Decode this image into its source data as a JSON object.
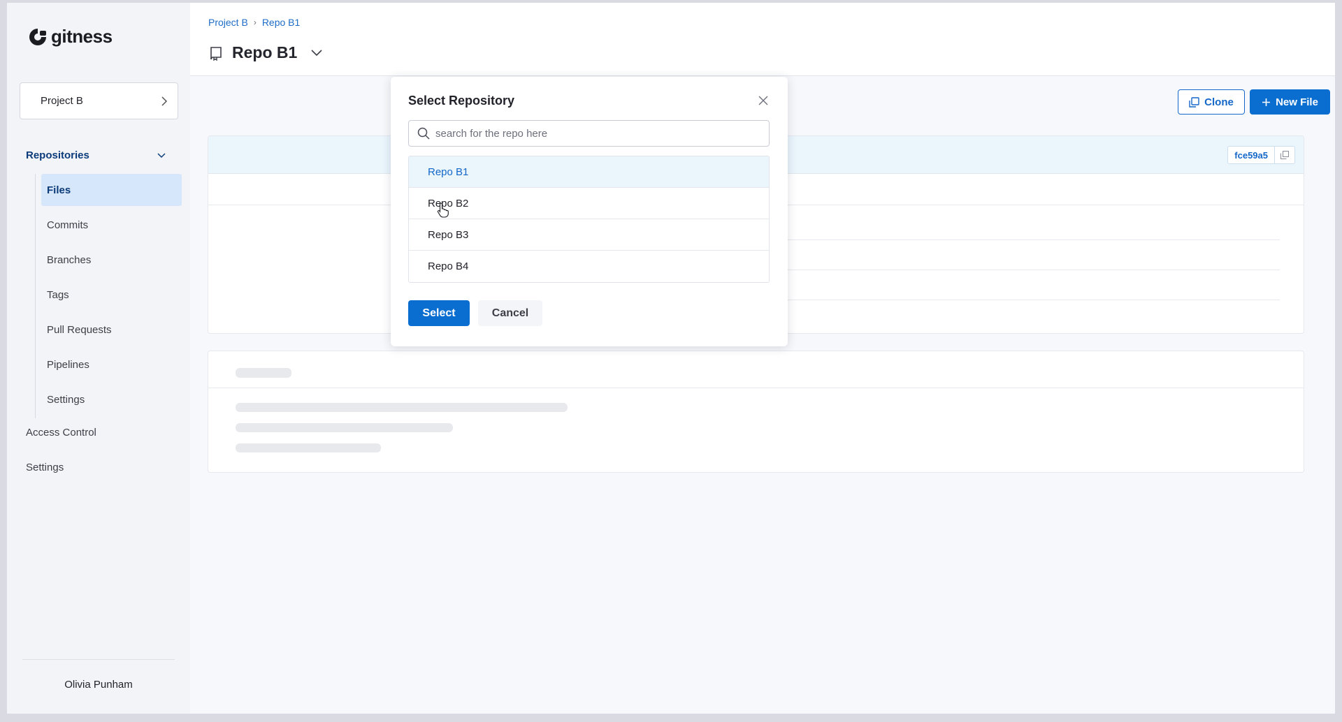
{
  "app": {
    "name": "gitness"
  },
  "sidebar": {
    "project_label": "Project B",
    "section_label": "Repositories",
    "sub_items": [
      {
        "label": "Files",
        "active": true
      },
      {
        "label": "Commits"
      },
      {
        "label": "Branches"
      },
      {
        "label": "Tags"
      },
      {
        "label": "Pull Requests"
      },
      {
        "label": "Pipelines"
      },
      {
        "label": "Settings"
      }
    ],
    "top_items": [
      {
        "label": "Access Control"
      },
      {
        "label": "Settings"
      }
    ],
    "user_name": "Olivia Punham"
  },
  "header": {
    "breadcrumb": [
      "Project B",
      "Repo B1"
    ],
    "title": "Repo B1"
  },
  "toolbar": {
    "clone_label": "Clone",
    "new_file_label": "New File"
  },
  "commit": {
    "sha": "fce59a5"
  },
  "modal": {
    "title": "Select Repository",
    "search_placeholder": "search for the repo here",
    "repos": [
      {
        "label": "Repo B1",
        "selected": true
      },
      {
        "label": "Repo B2"
      },
      {
        "label": "Repo B3"
      },
      {
        "label": "Repo B4"
      }
    ],
    "select_label": "Select",
    "cancel_label": "Cancel"
  },
  "colors": {
    "accent": "#0a6ed1",
    "link": "#1467c9",
    "active_nav_bg": "#d6e7fb",
    "selected_row_bg": "#eaf5fc"
  }
}
